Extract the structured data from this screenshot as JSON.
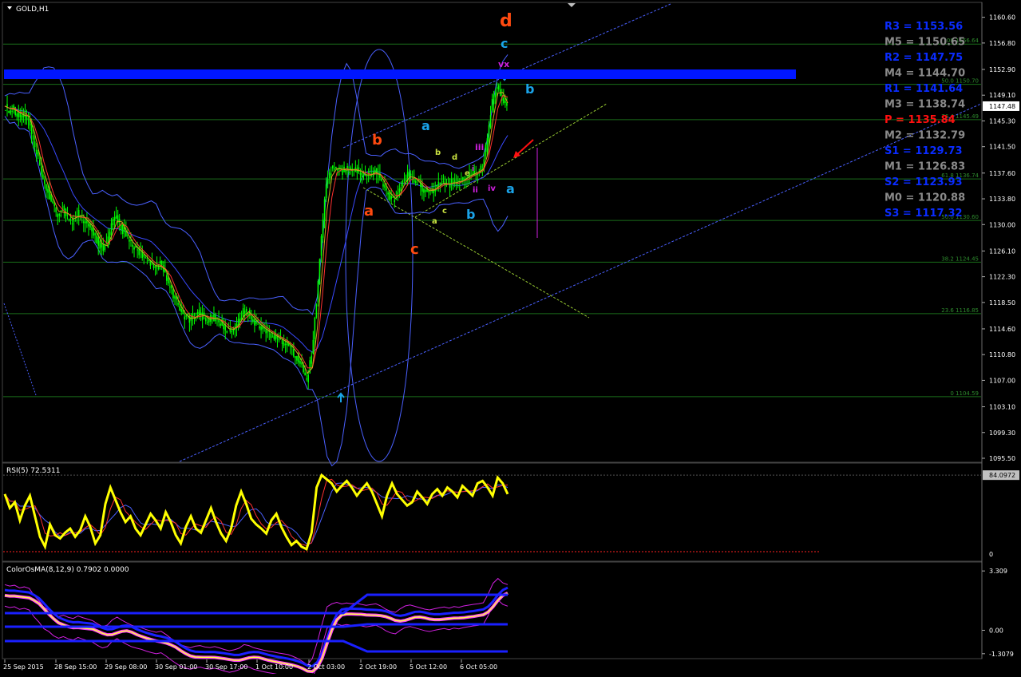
{
  "window": {
    "main_title": "GOLD,H1",
    "rsi_title": "RSI(5) 72.5311",
    "osma_title": "ColorOsMA(8,12,9) 0.7902 0.0000"
  },
  "colors": {
    "background": "#000000",
    "grid": "#1a6e1a",
    "candle": "#00ff00",
    "band": "#4a60ff",
    "pivot_bar": "#0016ff",
    "wave_orange": "#ff4a10",
    "wave_cyan": "#1aa3e8",
    "wave_magenta": "#d020e0",
    "wave_yellow": "#c8e040",
    "rsi_line": "#ffff00",
    "pivot_blue": "#0a2cff",
    "pivot_gray": "#8a8a8a",
    "pivot_red": "#ff1010"
  },
  "chart_data": [
    {
      "type": "candlestick",
      "symbol": "GOLD",
      "timeframe": "H1",
      "ylim": [
        1095.5,
        1161.5
      ],
      "price_ticks": [
        "1160.60",
        "1156.80",
        "1152.90",
        "1149.10",
        "1145.30",
        "1141.50",
        "1137.60",
        "1133.80",
        "1130.00",
        "1126.10",
        "1122.30",
        "1118.50",
        "1114.60",
        "1110.80",
        "1107.00",
        "1103.10",
        "1099.30",
        "1095.50"
      ],
      "current_price": "1147.48",
      "time_labels": [
        "25 Sep 2015",
        "28 Sep 15:00",
        "29 Sep 08:00",
        "30 Sep 01:00",
        "30 Sep 17:00",
        "1 Oct 10:00",
        "2 Oct 03:00",
        "2 Oct 19:00",
        "5 Oct 12:00",
        "6 Oct 05:00"
      ],
      "approx_close": [
        1147.5,
        1146.8,
        1147.2,
        1145.9,
        1146.4,
        1145.6,
        1142.1,
        1139.5,
        1136.2,
        1134.8,
        1132.6,
        1131.4,
        1132.2,
        1131.1,
        1130.5,
        1131.8,
        1130.9,
        1130.2,
        1129.4,
        1127.8,
        1126.5,
        1127.2,
        1129.8,
        1131.2,
        1129.6,
        1128.3,
        1127.1,
        1126.4,
        1125.8,
        1124.9,
        1124.2,
        1123.6,
        1124.1,
        1122.5,
        1120.6,
        1118.9,
        1117.3,
        1116.5,
        1115.8,
        1116.6,
        1116.9,
        1116.2,
        1115.9,
        1116.4,
        1115.7,
        1114.9,
        1114.3,
        1114.8,
        1115.6,
        1117.4,
        1116.9,
        1115.8,
        1115.2,
        1114.6,
        1114.1,
        1113.7,
        1113.2,
        1112.8,
        1112.4,
        1111.5,
        1110.4,
        1108.9,
        1107.2,
        1110.5,
        1118.6,
        1127.9,
        1136.4,
        1137.9,
        1138.6,
        1137.8,
        1138.3,
        1137.9,
        1138.2,
        1137.6,
        1137.1,
        1137.5,
        1137.9,
        1136.8,
        1135.2,
        1134.1,
        1133.6,
        1135.4,
        1136.8,
        1137.3,
        1136.6,
        1135.9,
        1135.2,
        1134.8,
        1135.4,
        1135.9,
        1136.3,
        1135.7,
        1136.5,
        1136.1,
        1136.8,
        1137.2,
        1137.6,
        1137.9,
        1138.4,
        1142.8,
        1148.2,
        1150.6,
        1148.4,
        1147.5
      ],
      "fib_levels": [
        {
          "label": "100 1156.64",
          "price": 1156.64
        },
        {
          "label": "50.0 1150.70",
          "price": 1150.7
        },
        {
          "label": "76.4 1145.49",
          "price": 1145.49
        },
        {
          "label": "61.8 1136.74",
          "price": 1136.74
        },
        {
          "label": "50.0 1130.60",
          "price": 1130.6
        },
        {
          "label": "38.2 1124.45",
          "price": 1124.45
        },
        {
          "label": "23.6 1116.85",
          "price": 1116.85
        },
        {
          "label": "0 1104.59",
          "price": 1104.59
        }
      ],
      "pivots": [
        {
          "label": "R3 = 1153.56",
          "price": 1153.56,
          "color": "#0a2cff"
        },
        {
          "label": "M5 = 1150.65",
          "price": 1150.65,
          "color": "#8a8a8a"
        },
        {
          "label": "R2 = 1147.75",
          "price": 1147.75,
          "color": "#0a2cff"
        },
        {
          "label": "M4 = 1144.70",
          "price": 1144.7,
          "color": "#8a8a8a"
        },
        {
          "label": "R1 = 1141.64",
          "price": 1141.64,
          "color": "#0a2cff"
        },
        {
          "label": "M3 = 1138.74",
          "price": 1138.74,
          "color": "#8a8a8a"
        },
        {
          "label": "P  = 1135.84",
          "price": 1135.84,
          "color": "#ff1010"
        },
        {
          "label": "M2 = 1132.79",
          "price": 1132.79,
          "color": "#8a8a8a"
        },
        {
          "label": "S1 = 1129.73",
          "price": 1129.73,
          "color": "#0a2cff"
        },
        {
          "label": "M1 = 1126.83",
          "price": 1126.83,
          "color": "#8a8a8a"
        },
        {
          "label": "S2 = 1123.93",
          "price": 1123.93,
          "color": "#0a2cff"
        },
        {
          "label": "M0 = 1120.88",
          "price": 1120.88,
          "color": "#8a8a8a"
        },
        {
          "label": "S3 = 1117.32",
          "price": 1117.32,
          "color": "#0a2cff"
        }
      ],
      "wave_labels": [
        {
          "text": "d",
          "color": "#ff4a10"
        },
        {
          "text": "c",
          "color": "#1aa3e8"
        },
        {
          "text": "vx",
          "color": "#d020e0"
        },
        {
          "text": "b",
          "color": "#1aa3e8"
        },
        {
          "text": "a",
          "color": "#1aa3e8"
        },
        {
          "text": "b",
          "color": "#ff4a10"
        },
        {
          "text": "iii",
          "color": "#d020e0"
        },
        {
          "text": "b",
          "color": "#c8e040"
        },
        {
          "text": "d",
          "color": "#c8e040"
        },
        {
          "text": "e",
          "color": "#c8e040"
        },
        {
          "text": "i",
          "color": "#d020e0"
        },
        {
          "text": "ii",
          "color": "#d020e0"
        },
        {
          "text": "iv",
          "color": "#d020e0"
        },
        {
          "text": "a",
          "color": "#1aa3e8"
        },
        {
          "text": "a",
          "color": "#ff4a10"
        },
        {
          "text": "c",
          "color": "#c8e040"
        },
        {
          "text": "a",
          "color": "#c8e040"
        },
        {
          "text": "b",
          "color": "#1aa3e8"
        },
        {
          "text": "c",
          "color": "#ff4a10"
        }
      ]
    },
    {
      "type": "line",
      "indicator": "RSI",
      "period": 5,
      "value": "72.5311",
      "ylim": [
        0,
        100
      ],
      "level_label": "84.0972",
      "zero_label": "0",
      "values": [
        72,
        55,
        62,
        40,
        58,
        70,
        45,
        20,
        8,
        35,
        22,
        18,
        25,
        30,
        20,
        28,
        45,
        32,
        12,
        22,
        60,
        80,
        65,
        50,
        38,
        45,
        30,
        22,
        35,
        48,
        40,
        30,
        50,
        38,
        22,
        12,
        32,
        45,
        30,
        25,
        40,
        55,
        38,
        24,
        15,
        30,
        58,
        75,
        60,
        42,
        35,
        30,
        24,
        40,
        48,
        32,
        20,
        10,
        15,
        8,
        5,
        25,
        80,
        95,
        90,
        85,
        75,
        82,
        88,
        80,
        70,
        78,
        85,
        75,
        60,
        45,
        70,
        85,
        72,
        65,
        58,
        62,
        75,
        68,
        60,
        72,
        78,
        70,
        80,
        75,
        68,
        82,
        76,
        70,
        85,
        88,
        80,
        70,
        92,
        85,
        72
      ]
    },
    {
      "type": "line",
      "indicator": "ColorOsMA",
      "params": "8,12,9",
      "values_label": "0.7902 0.0000",
      "ylim": [
        -1.45,
        3.45
      ],
      "tick_labels": [
        "3.309",
        "0.00",
        "-1.3079"
      ]
    }
  ]
}
